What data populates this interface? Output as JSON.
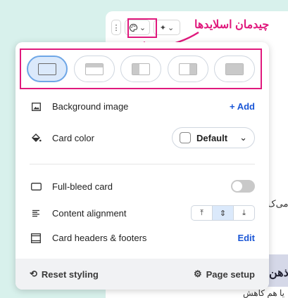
{
  "annotation": {
    "label": "چیدمان اسلایدها",
    "color": "#e0197d"
  },
  "background": {
    "text_1": "می‌ک",
    "text_2": "ذهن",
    "text_3": "یا هم کاهش"
  },
  "toolbar": {
    "more_icon": "vertical-dots-icon",
    "theme_icon": "palette-icon",
    "ai_icon": "sparkle-icon"
  },
  "layouts": [
    {
      "name": "blank",
      "selected": true
    },
    {
      "name": "header",
      "selected": false
    },
    {
      "name": "left-image",
      "selected": false
    },
    {
      "name": "right-image",
      "selected": false
    },
    {
      "name": "full-image",
      "selected": false
    }
  ],
  "background_image": {
    "label": "Background image",
    "action": "+ Add"
  },
  "card_color": {
    "label": "Card color",
    "value": "Default"
  },
  "full_bleed": {
    "label": "Full-bleed card",
    "enabled": false
  },
  "content_alignment": {
    "label": "Content alignment",
    "options": [
      "top",
      "middle",
      "bottom"
    ],
    "selected": "middle"
  },
  "card_headers": {
    "label": "Card headers & footers",
    "action": "Edit"
  },
  "footer": {
    "reset_label": "Reset styling",
    "setup_label": "Page setup"
  },
  "colors": {
    "accent": "#1a56d6",
    "selected_bg": "#dbe9fb",
    "annotation": "#e0197d"
  }
}
